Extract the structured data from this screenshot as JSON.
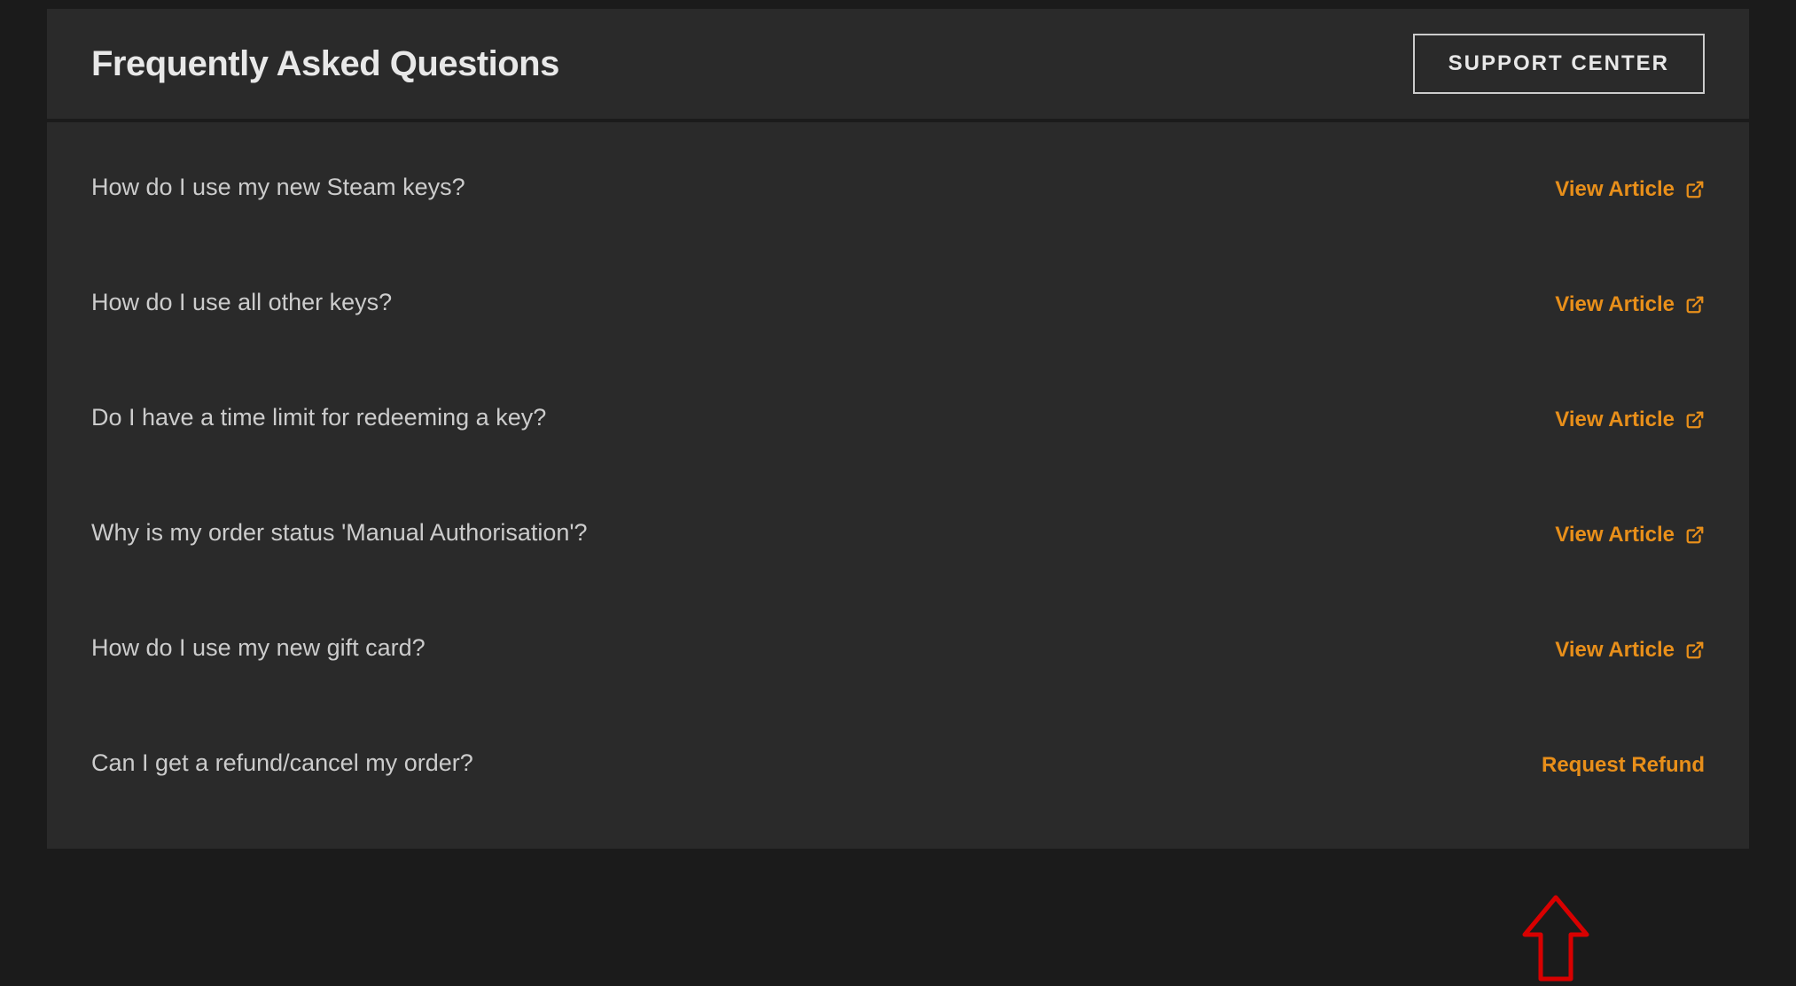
{
  "header": {
    "title": "Frequently Asked Questions",
    "support_button": "SUPPORT CENTER"
  },
  "faq": {
    "view_article_label": "View Article",
    "items": [
      {
        "question": "How do I use my new Steam keys?",
        "action_type": "article"
      },
      {
        "question": "How do I use all other keys?",
        "action_type": "article"
      },
      {
        "question": "Do I have a time limit for redeeming a key?",
        "action_type": "article"
      },
      {
        "question": "Why is my order status 'Manual Authorisation'?",
        "action_type": "article"
      },
      {
        "question": "How do I use my new gift card?",
        "action_type": "article"
      },
      {
        "question": "Can I get a refund/cancel my order?",
        "action_type": "refund",
        "action_label": "Request Refund"
      }
    ]
  },
  "colors": {
    "accent": "#e88f1a",
    "background_dark": "#1b1b1b",
    "panel": "#2a2a2a",
    "text_primary": "#e8e8e8",
    "text_secondary": "#cccccc",
    "annotation": "#d80000"
  },
  "annotation": {
    "type": "up-arrow",
    "target": "request-refund-link"
  }
}
